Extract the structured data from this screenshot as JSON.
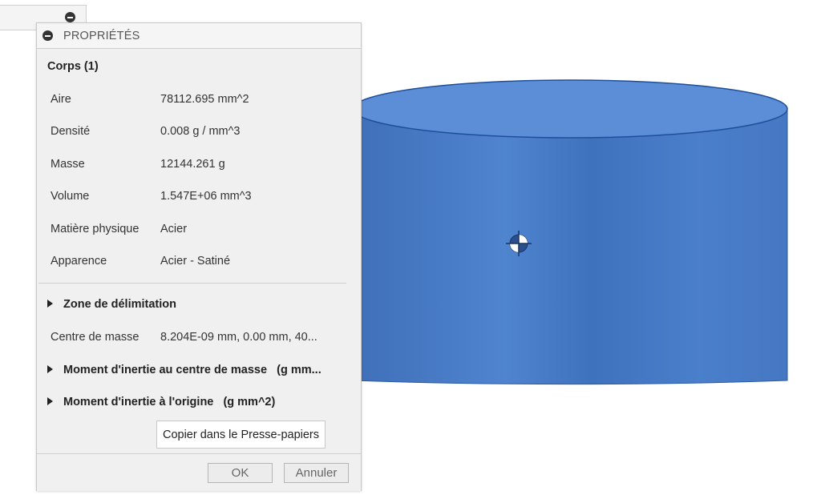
{
  "colors": {
    "cylinder_top": "#5b8fd6",
    "cylinder_side": "#4a7cc6",
    "cylinder_edge": "#1f4f99",
    "dialog_bg": "#f0f0f0"
  },
  "viewport": {
    "center_marker_icon": "center-of-mass-icon"
  },
  "mini_tab": {
    "icon": "collapse-icon"
  },
  "dialog": {
    "title": "PROPRIÉTÉS",
    "collapse_icon": "collapse-icon",
    "section": "Corps (1)",
    "properties": [
      {
        "label": "Aire",
        "value": "78112.695 mm^2"
      },
      {
        "label": "Densité",
        "value": "0.008 g / mm^3"
      },
      {
        "label": "Masse",
        "value": "12144.261 g"
      },
      {
        "label": "Volume",
        "value": "1.547E+06 mm^3"
      },
      {
        "label": "Matière physique",
        "value": "Acier"
      },
      {
        "label": "Apparence",
        "value": "Acier - Satiné"
      }
    ],
    "bounding_box": "Zone de délimitation",
    "center_of_mass": {
      "label": "Centre de masse",
      "value": "8.204E-09 mm, 0.00 mm, 40..."
    },
    "inertia_center": "Moment d'inertie au centre de masse   (g mm...",
    "inertia_origin": "Moment d'inertie à l'origine   (g mm^2)",
    "copy_button": "Copier dans le Presse-papiers",
    "ok_button": "OK",
    "cancel_button": "Annuler"
  }
}
